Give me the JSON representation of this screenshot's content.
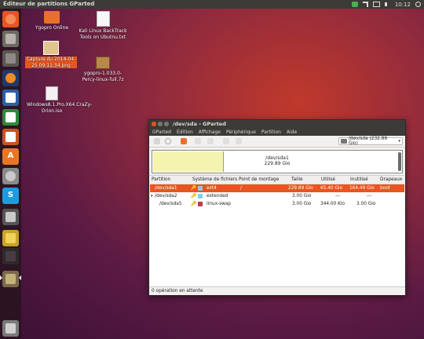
{
  "top_panel": {
    "title": "Éditeur de partitions GParted",
    "clock": "10:12"
  },
  "launcher": {
    "items": [
      "files",
      "folder-home",
      "calculator",
      "firefox",
      "writer",
      "calc",
      "impress",
      "software-center",
      "skype",
      "drive",
      "files-2",
      "terminal",
      "gparted",
      "trash"
    ]
  },
  "desktop": {
    "icons": [
      {
        "label": "Ygopro Online"
      },
      {
        "label": "Kali Linux BackTrack Tools on Ubutnu.txt"
      },
      {
        "label": "Capture du 2014-04-25 09:11:34.png"
      },
      {
        "label": "ygopro-1.033.0-Percy-linux-full.7z"
      },
      {
        "label": "Windows8.1.Pro.X64.CraZy-Orion.iso"
      }
    ]
  },
  "window": {
    "title": "/dev/sda - GParted",
    "menu": [
      "GParted",
      "Édition",
      "Affichage",
      "Périphérique",
      "Partition",
      "Aide"
    ],
    "device_selector": "/dev/sda  (232.89 Gio)",
    "disk_label": "/dev/sda1",
    "disk_size": "229.89 Gio",
    "columns": [
      "Partition",
      "Système de fichiers",
      "Point de montage",
      "Taille",
      "Utilisé",
      "Inutilisé",
      "Drapeaux"
    ],
    "rows": [
      {
        "partition": "/dev/sda1",
        "fs": "ext4",
        "mount": "/",
        "size": "229.89 Gio",
        "used": "65.40 Gio",
        "unused": "164.49 Gio",
        "flags": "boot",
        "fs_color": "#9cc3e6",
        "selected": true
      },
      {
        "partition": "/dev/sda2",
        "fs": "extended",
        "mount": "",
        "size": "3.00 Gio",
        "used": "---",
        "unused": "---",
        "flags": "",
        "fs_color": "#7dd3e8",
        "selected": false
      },
      {
        "partition": "/dev/sda5",
        "fs": "linux-swap",
        "mount": "",
        "size": "3.00 Gio",
        "used": "344.00 Kio",
        "unused": "3.00 Gio",
        "flags": "",
        "fs_color": "#c0394b",
        "selected": false
      }
    ],
    "status": "0 opération en attente"
  },
  "colors": {
    "accent": "#e95420",
    "panel": "#3c3b37"
  }
}
